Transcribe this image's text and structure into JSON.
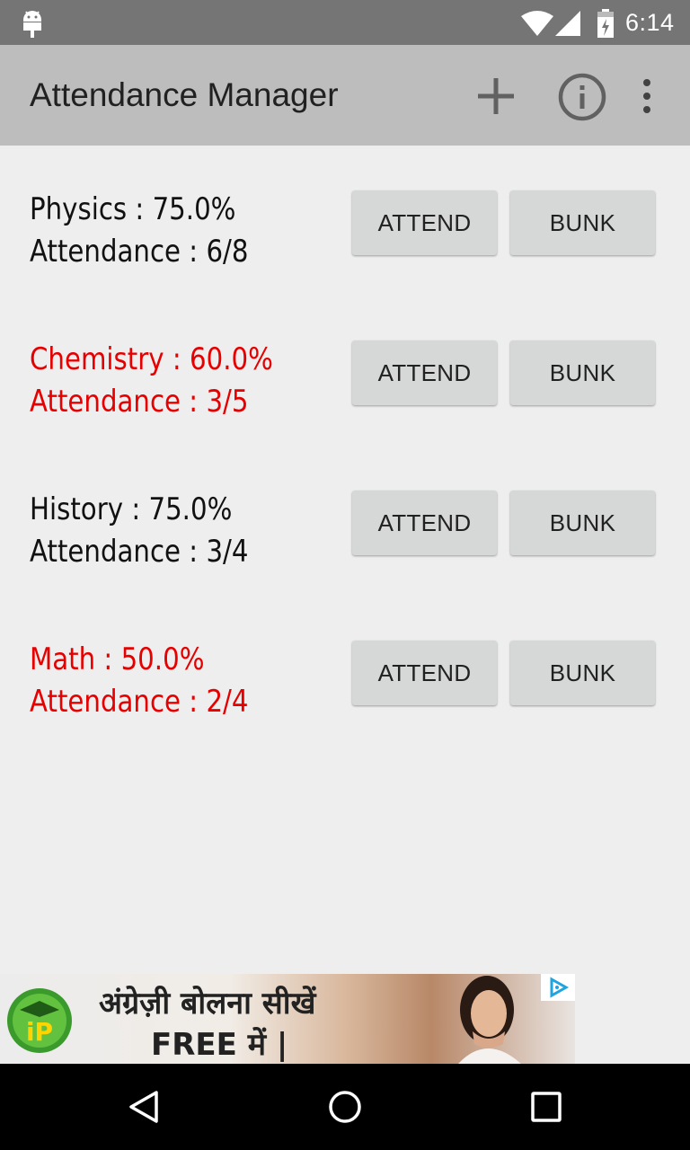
{
  "status_bar": {
    "time": "6:14",
    "icons": [
      "android-icon",
      "wifi-icon",
      "signal-icon",
      "battery-icon"
    ]
  },
  "app_bar": {
    "title": "Attendance Manager",
    "actions": [
      "add-icon",
      "info-icon",
      "overflow-menu-icon"
    ]
  },
  "subjects": [
    {
      "name_line": "Physics : 75.0%",
      "attendance_line": "Attendance : 6/8",
      "status": "normal",
      "attend_label": "ATTEND",
      "bunk_label": "BUNK"
    },
    {
      "name_line": "Chemistry : 60.0%",
      "attendance_line": "Attendance : 3/5",
      "status": "low",
      "attend_label": "ATTEND",
      "bunk_label": "BUNK"
    },
    {
      "name_line": "History : 75.0%",
      "attendance_line": "Attendance : 3/4",
      "status": "normal",
      "attend_label": "ATTEND",
      "bunk_label": "BUNK"
    },
    {
      "name_line": "Math : 50.0%",
      "attendance_line": "Attendance : 2/4",
      "status": "low",
      "attend_label": "ATTEND",
      "bunk_label": "BUNK"
    }
  ],
  "ad": {
    "line1": "अंग्रेज़ी बोलना सीखें",
    "line2": "FREE में |",
    "logo_text": "iP"
  },
  "nav_bar": {
    "icons": [
      "back-icon",
      "home-icon",
      "recents-icon"
    ]
  },
  "colors": {
    "app_bar": "#bdbdbd",
    "status_bar": "#757575",
    "background": "#eeeeee",
    "low_attendance": "#e60000",
    "button": "#d6d7d7"
  }
}
